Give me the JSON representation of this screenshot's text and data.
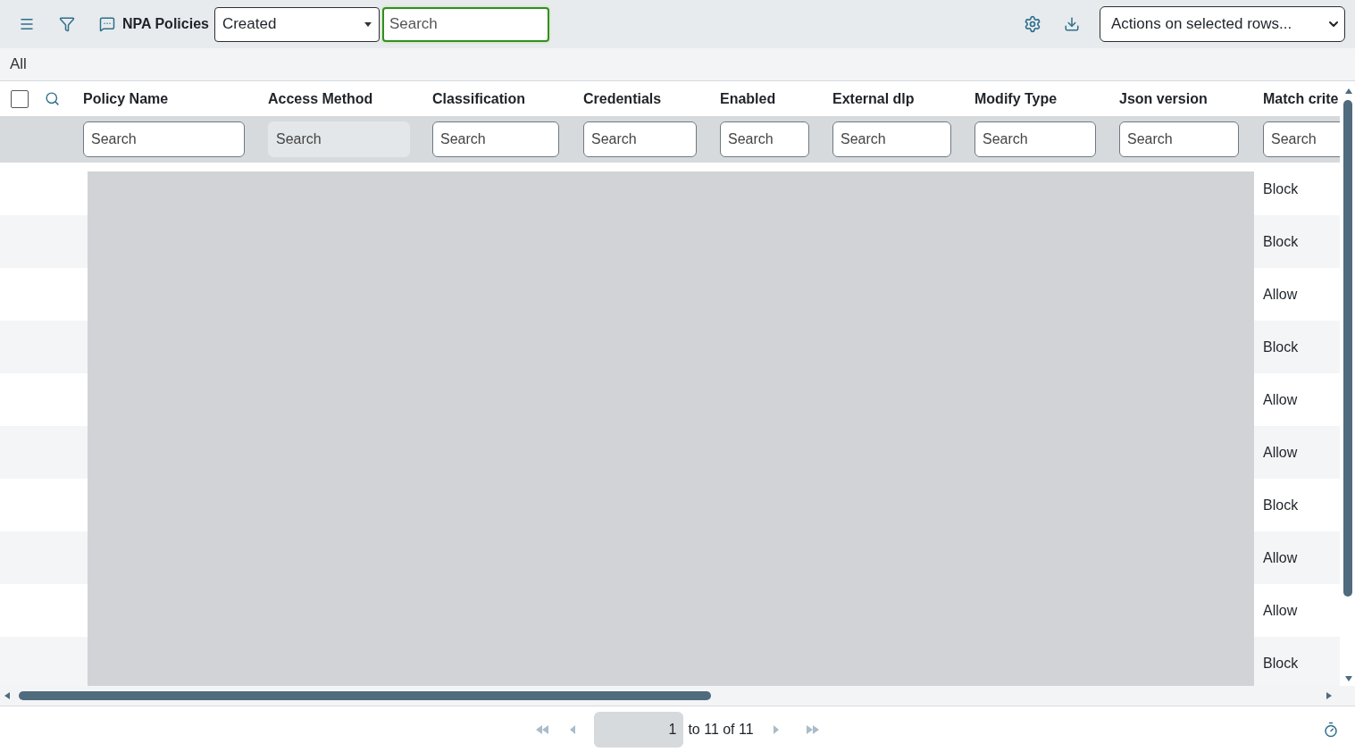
{
  "toolbar": {
    "title": "NPA Policies",
    "view_select": {
      "value": "Created"
    },
    "search": {
      "placeholder": "Search",
      "focused": true
    },
    "actions_select": {
      "value": "Actions on selected rows..."
    }
  },
  "view_label": "All",
  "table": {
    "select_all": {
      "checked": false
    },
    "columns": [
      {
        "label": "Policy Name",
        "filter_placeholder": "Search",
        "filter_disabled": false
      },
      {
        "label": "Access Method",
        "filter_placeholder": "Search",
        "filter_disabled": true
      },
      {
        "label": "Classification",
        "filter_placeholder": "Search",
        "filter_disabled": false
      },
      {
        "label": "Credentials",
        "filter_placeholder": "Search",
        "filter_disabled": false
      },
      {
        "label": "Enabled",
        "filter_placeholder": "Search",
        "filter_disabled": false
      },
      {
        "label": "External dlp",
        "filter_placeholder": "Search",
        "filter_disabled": false
      },
      {
        "label": "Modify Type",
        "filter_placeholder": "Search",
        "filter_disabled": false
      },
      {
        "label": "Json version",
        "filter_placeholder": "Search",
        "filter_disabled": false
      },
      {
        "label": "Match crite",
        "filter_placeholder": "Search",
        "filter_disabled": false
      }
    ],
    "rows": [
      {
        "match_criteria": "Block"
      },
      {
        "match_criteria": "Block"
      },
      {
        "match_criteria": "Allow"
      },
      {
        "match_criteria": "Block"
      },
      {
        "match_criteria": "Allow"
      },
      {
        "match_criteria": "Allow"
      },
      {
        "match_criteria": "Block"
      },
      {
        "match_criteria": "Allow"
      },
      {
        "match_criteria": "Allow"
      },
      {
        "match_criteria": "Block"
      }
    ],
    "redacted": true
  },
  "pagination": {
    "page": "1",
    "summary": "to 11 of 11"
  }
}
